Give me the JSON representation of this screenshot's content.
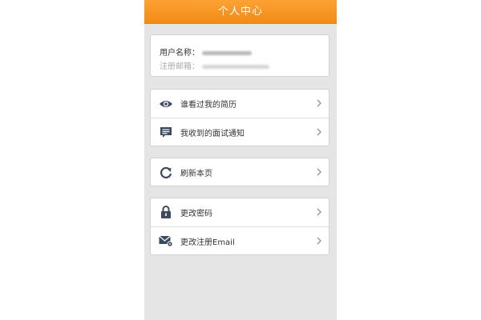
{
  "header": {
    "title": "个人中心"
  },
  "profile": {
    "username_label": "用户名称：",
    "email_label": "注册邮箱："
  },
  "menu_groups": [
    {
      "items": [
        {
          "label": "谁看过我的简历",
          "icon": "eye-icon"
        },
        {
          "label": "我收到的面试通知",
          "icon": "message-icon"
        }
      ]
    },
    {
      "items": [
        {
          "label": "刷新本页",
          "icon": "refresh-icon"
        }
      ]
    },
    {
      "items": [
        {
          "label": "更改密码",
          "icon": "lock-icon"
        },
        {
          "label": "更改注册Email",
          "icon": "mail-settings-icon"
        }
      ]
    }
  ],
  "colors": {
    "header": "#f5941e",
    "icon": "#3b4a5e",
    "background": "#e5e5e5"
  }
}
